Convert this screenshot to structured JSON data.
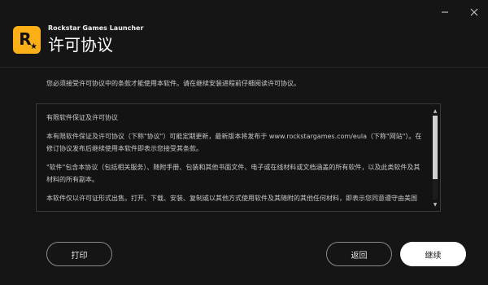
{
  "window": {
    "minimize_icon": "minimize-icon",
    "close_icon": "close-icon"
  },
  "header": {
    "app_name": "Rockstar Games Launcher",
    "title": "许可协议",
    "logo_letter": "R",
    "logo_star": "★",
    "brand_color": "#fcaf17"
  },
  "intro_text": "您必须接受许可协议中的条款才能使用本软件。请在继续安装进程前仔细阅读许可协议。",
  "eula": {
    "paragraphs": [
      "有限软件保证及许可协议",
      "本有限软件保证及许可协议（下称\"协议\"）可能定期更新，最新版本将发布于 www.rockstargames.com/eula（下称\"网站\"）。在修订协议发布后继续使用本软件即表示您接受其条款。",
      "\"软件\"包含本协议（包括相关服务）、随附手册、包装和其他书面文件、电子或在线材料或文档涵盖的所有软件，以及此类软件及其材料的所有副本。",
      "本软件仅以许可证形式出售。打开、下载、安装、复制或以其他方式使用软件及其随附的其他任何材料，即表示您同意遵守由美国"
    ],
    "scroll_position_fraction": 0.0
  },
  "buttons": {
    "print": "打印",
    "back": "返回",
    "continue": "继续"
  }
}
